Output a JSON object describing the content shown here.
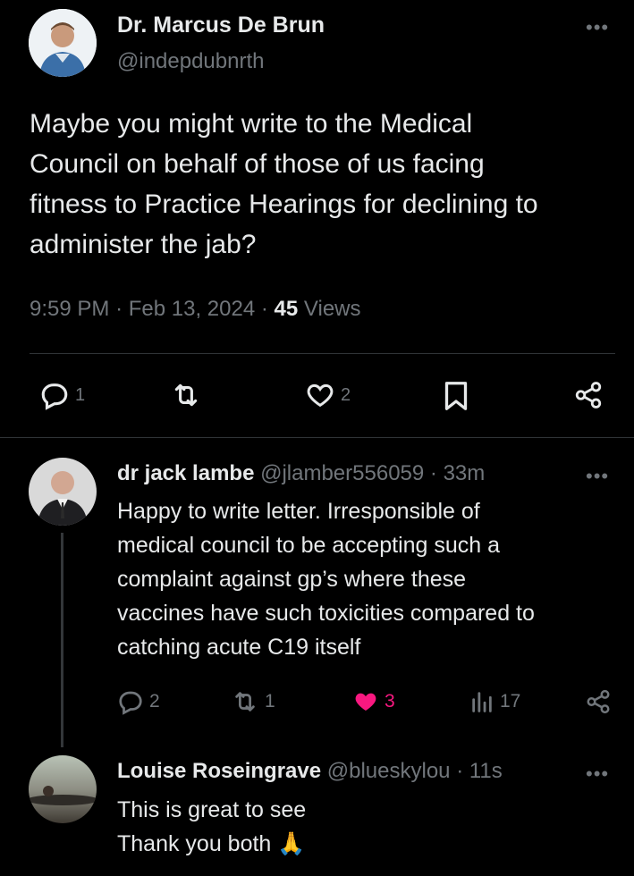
{
  "main_post": {
    "author_name": "Dr. Marcus De Brun",
    "handle": "@indepdubnrth",
    "text_lines": [
      "Maybe you might write to the Medical",
      "Council on behalf of those of us facing",
      "fitness to Practice Hearings for declining to",
      "administer the jab?"
    ],
    "time": "9:59 PM",
    "date": "Feb 13, 2024",
    "views_count": "45",
    "views_label": "Views",
    "separator": "·",
    "actions": {
      "replies": "1",
      "likes": "2"
    }
  },
  "reply_1": {
    "author_name": "dr jack lambe",
    "handle": "@jlamber556059",
    "time": "33m",
    "separator": "·",
    "text_lines": [
      "Happy to write letter. Irresponsible of",
      "medical council to be accepting such a",
      "complaint against gp’s where these",
      "vaccines have such toxicities compared to",
      "catching acute C19 itself"
    ],
    "actions": {
      "replies": "2",
      "reposts": "1",
      "likes": "3",
      "views": "17"
    },
    "liked_color": "#f91880"
  },
  "reply_2": {
    "author_name": "Louise Roseingrave",
    "handle": "@blueskylou",
    "time": "11s",
    "separator": "·",
    "text_lines": [
      "This is great to see",
      "Thank you both"
    ],
    "emoji": "🙏"
  },
  "colors": {
    "background": "#000000",
    "text": "#e7e9ea",
    "muted": "#71767b",
    "divider": "#2f3336",
    "like": "#f91880"
  },
  "icons": [
    "more-icon",
    "reply-icon",
    "repost-icon",
    "like-icon",
    "bookmark-icon",
    "share-icon",
    "views-icon"
  ]
}
